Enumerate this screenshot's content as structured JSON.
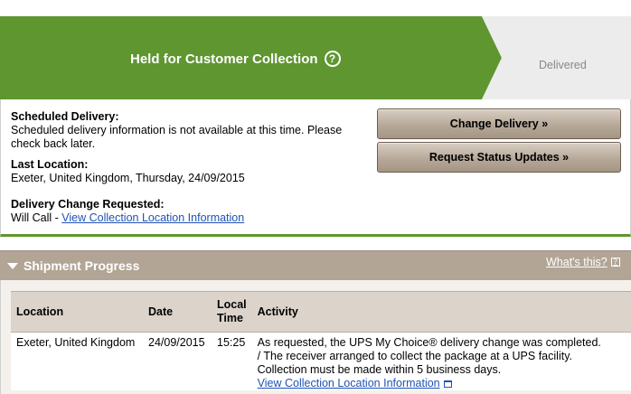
{
  "banner": {
    "status_title": "Held for Customer Collection",
    "help_glyph": "?",
    "next_step": "Delivered",
    "colors": {
      "active": "#5f9630",
      "inactive": "#ececec"
    }
  },
  "summary": {
    "scheduled_label": "Scheduled Delivery:",
    "scheduled_text": "Scheduled delivery information is not available at this time. Please check back later.",
    "last_location_label": "Last Location:",
    "last_location_text": "Exeter, United Kingdom, Thursday, 24/09/2015",
    "change_requested_label": "Delivery Change Requested:",
    "change_requested_prefix": "Will Call - ",
    "change_requested_link": "View Collection Location Information"
  },
  "actions": {
    "change_delivery": "Change Delivery »",
    "request_updates": "Request Status Updates »"
  },
  "progress": {
    "title": "Shipment Progress",
    "whats_this": "What's this?",
    "columns": {
      "location": "Location",
      "date": "Date",
      "local_time_1": "Local",
      "local_time_2": "Time",
      "activity": "Activity"
    },
    "rows": [
      {
        "location": "Exeter, United Kingdom",
        "date": "24/09/2015",
        "time": "15:25",
        "activity_line1": "As requested, the UPS My Choice® delivery change was completed.",
        "activity_line2": "/ The receiver arranged to collect the package at a UPS facility.",
        "activity_line3": "Collection must be made within 5 business days.",
        "activity_link": "View Collection Location Information"
      }
    ]
  }
}
